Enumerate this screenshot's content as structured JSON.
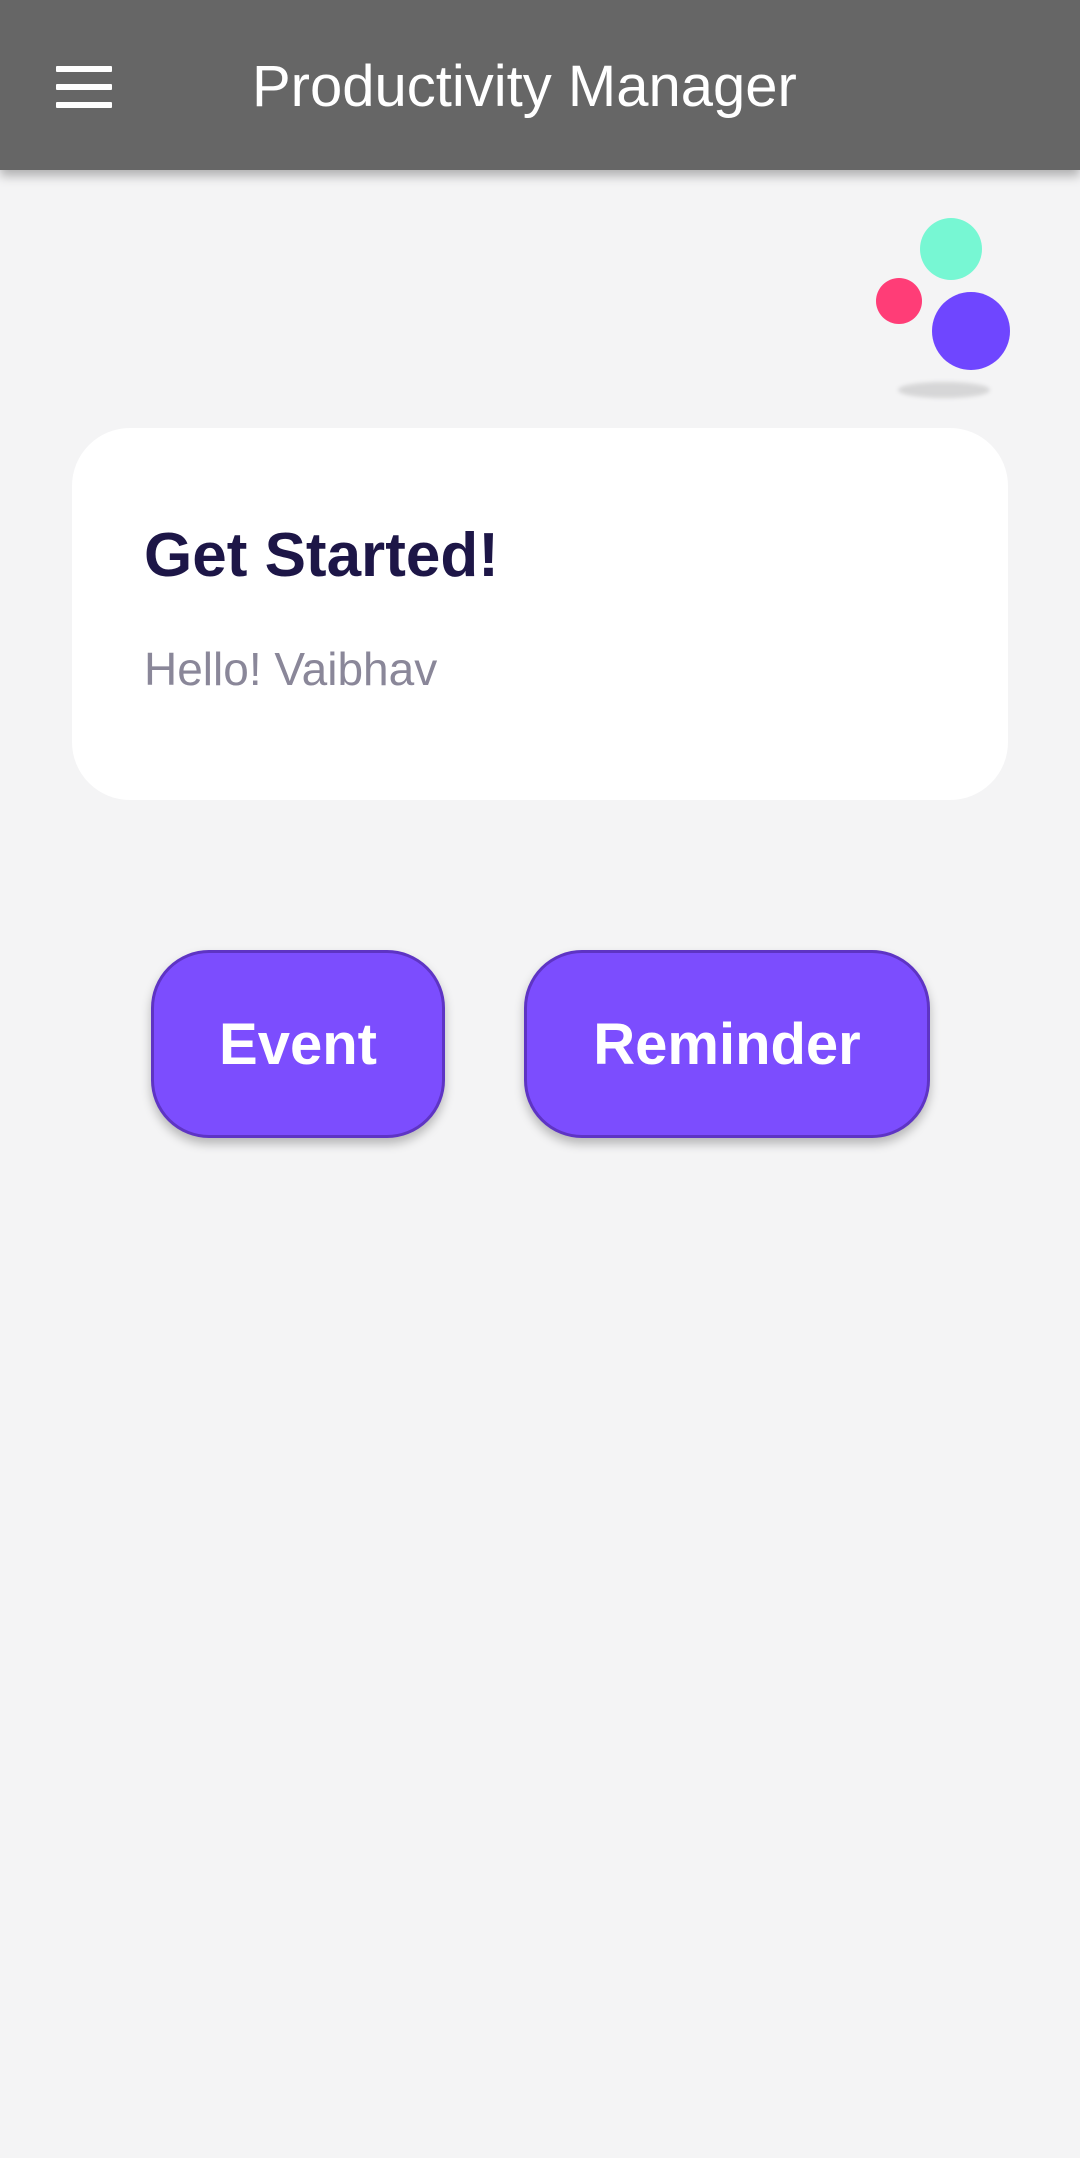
{
  "app_bar": {
    "title": "Productivity Manager",
    "menu_icon": "hamburger-menu-icon",
    "background": "#666666"
  },
  "illustration": {
    "name": "colored-dots-logo",
    "colors": [
      "#77f7d3",
      "#ff3d77",
      "#6f46ff"
    ]
  },
  "card": {
    "title": "Get Started!",
    "subtitle": "Hello! Vaibhav"
  },
  "actions": {
    "event_label": "Event",
    "reminder_label": "Reminder",
    "accent": "#7c4dfe"
  }
}
